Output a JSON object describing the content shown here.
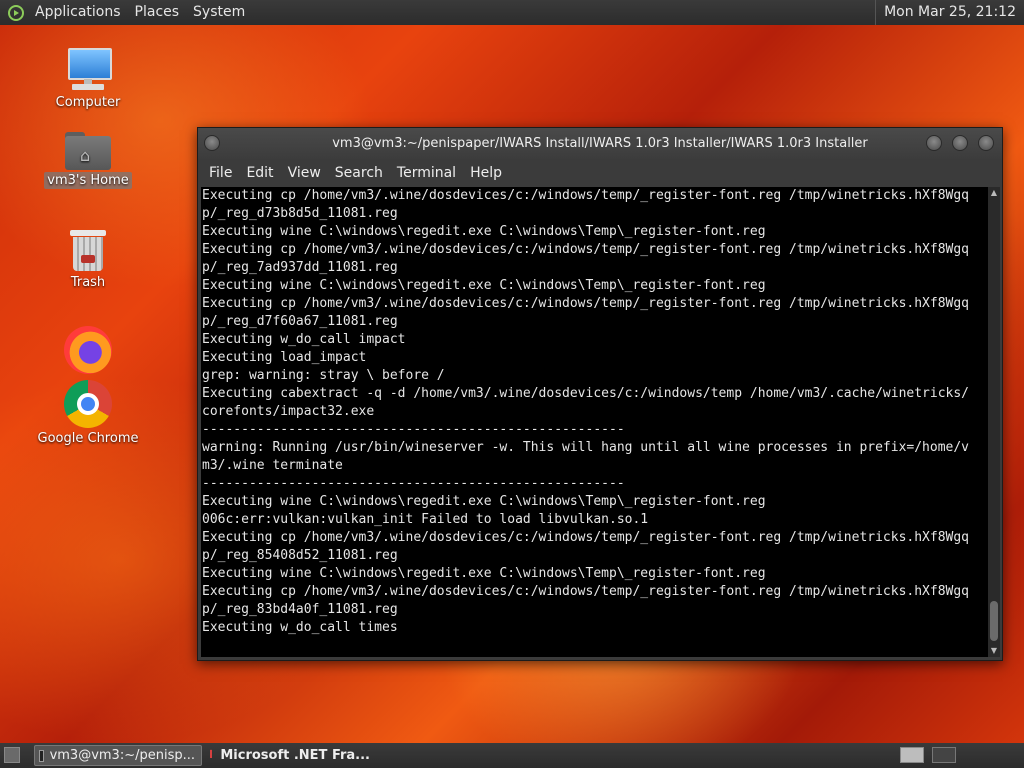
{
  "top_panel": {
    "menus": [
      "Applications",
      "Places",
      "System"
    ],
    "clock": "Mon Mar 25, 21:12"
  },
  "desktop": {
    "icons": [
      {
        "label": "Computer",
        "icon": "computer-icon"
      },
      {
        "label": "vm3's Home",
        "icon": "home-folder-icon",
        "selected": true
      },
      {
        "label": "Trash",
        "icon": "trash-icon"
      },
      {
        "label": "",
        "icon": "firefox-icon"
      },
      {
        "label": "Google Chrome",
        "icon": "chrome-icon"
      }
    ]
  },
  "terminal": {
    "title": "vm3@vm3:~/penispaper/IWARS Install/IWARS 1.0r3 Installer/IWARS 1.0r3 Installer",
    "menu": [
      "File",
      "Edit",
      "View",
      "Search",
      "Terminal",
      "Help"
    ],
    "lines": [
      "Executing cp /home/vm3/.wine/dosdevices/c:/windows/temp/_register-font.reg /tmp/winetricks.hXf8Wgq",
      "p/_reg_d73b8d5d_11081.reg",
      "Executing wine C:\\windows\\regedit.exe C:\\windows\\Temp\\_register-font.reg",
      "Executing cp /home/vm3/.wine/dosdevices/c:/windows/temp/_register-font.reg /tmp/winetricks.hXf8Wgq",
      "p/_reg_7ad937dd_11081.reg",
      "Executing wine C:\\windows\\regedit.exe C:\\windows\\Temp\\_register-font.reg",
      "Executing cp /home/vm3/.wine/dosdevices/c:/windows/temp/_register-font.reg /tmp/winetricks.hXf8Wgq",
      "p/_reg_d7f60a67_11081.reg",
      "Executing w_do_call impact",
      "Executing load_impact",
      "grep: warning: stray \\ before /",
      "Executing cabextract -q -d /home/vm3/.wine/dosdevices/c:/windows/temp /home/vm3/.cache/winetricks/",
      "corefonts/impact32.exe",
      "------------------------------------------------------",
      "warning: Running /usr/bin/wineserver -w. This will hang until all wine processes in prefix=/home/v",
      "m3/.wine terminate",
      "------------------------------------------------------",
      "Executing wine C:\\windows\\regedit.exe C:\\windows\\Temp\\_register-font.reg",
      "006c:err:vulkan:vulkan_init Failed to load libvulkan.so.1",
      "Executing cp /home/vm3/.wine/dosdevices/c:/windows/temp/_register-font.reg /tmp/winetricks.hXf8Wgq",
      "p/_reg_85408d52_11081.reg",
      "Executing wine C:\\windows\\regedit.exe C:\\windows\\Temp\\_register-font.reg",
      "Executing cp /home/vm3/.wine/dosdevices/c:/windows/temp/_register-font.reg /tmp/winetricks.hXf8Wgq",
      "p/_reg_83bd4a0f_11081.reg",
      "Executing w_do_call times"
    ]
  },
  "taskbar": {
    "tasks": [
      {
        "label": "vm3@vm3:~/penisp...",
        "active": true
      },
      {
        "label": "Microsoft .NET Fra...",
        "active": false
      }
    ]
  }
}
